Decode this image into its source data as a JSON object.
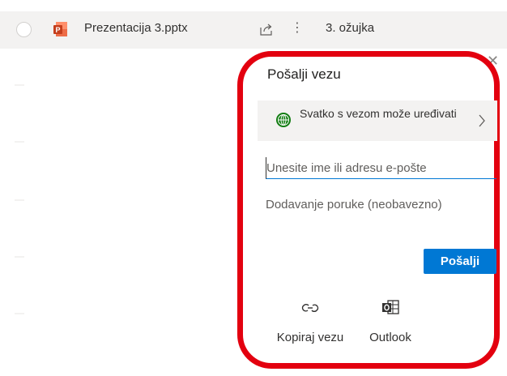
{
  "file": {
    "name": "Prezentacija 3.pptx",
    "modified": "3. ožujka",
    "type_icon": "powerpoint-icon"
  },
  "share_panel": {
    "title": "Pošalji vezu",
    "permission_text": "Svatko s vezom može uređivati",
    "email_placeholder": "Unesite ime ili adresu e-pošte",
    "message_placeholder": "Dodavanje poruke (neobavezno)",
    "send_label": "Pošalji",
    "copy_link_label": "Kopiraj vezu",
    "outlook_label": "Outlook"
  },
  "colors": {
    "accent": "#0078d4",
    "highlight_border": "#e3000f",
    "row_background": "#f3f2f1"
  }
}
